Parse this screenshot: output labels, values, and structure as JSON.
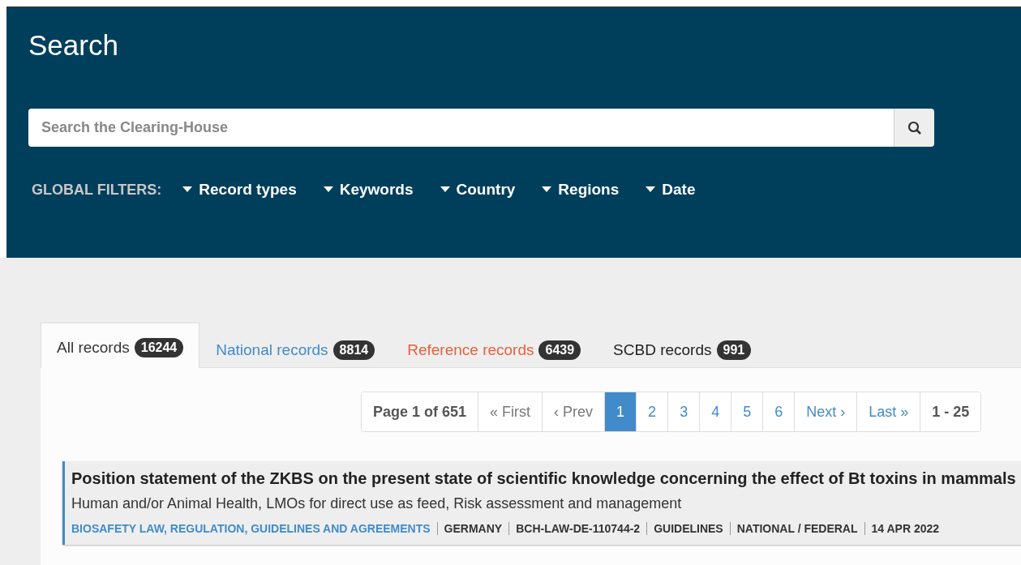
{
  "header": {
    "title": "Search",
    "search": {
      "placeholder": "Search the Clearing-House"
    },
    "filters_label": "GLOBAL FILTERS:",
    "filters": [
      "Record types",
      "Keywords",
      "Country",
      "Regions",
      "Date"
    ]
  },
  "tabs": [
    {
      "label": "All records",
      "count": "16244",
      "selected": true,
      "color": "#333333"
    },
    {
      "label": "National records",
      "count": "8814",
      "selected": false,
      "color": "#428bca"
    },
    {
      "label": "Reference records",
      "count": "6439",
      "selected": false,
      "color": "#e8603c"
    },
    {
      "label": "SCBD records",
      "count": "991",
      "selected": false,
      "color": "#222222"
    }
  ],
  "pager": [
    {
      "kind": "info",
      "label": "Page 1 of 651"
    },
    {
      "kind": "nav",
      "label": "« First",
      "disabled": true
    },
    {
      "kind": "nav",
      "label": "‹ Prev",
      "disabled": true
    },
    {
      "kind": "page",
      "label": "1",
      "selected": true
    },
    {
      "kind": "page",
      "label": "2",
      "selected": false
    },
    {
      "kind": "page",
      "label": "3",
      "selected": false
    },
    {
      "kind": "page",
      "label": "4",
      "selected": false
    },
    {
      "kind": "page",
      "label": "5",
      "selected": false
    },
    {
      "kind": "page",
      "label": "6",
      "selected": false
    },
    {
      "kind": "nav",
      "label": "Next ›",
      "disabled": false
    },
    {
      "kind": "nav",
      "label": "Last »",
      "disabled": false
    },
    {
      "kind": "info",
      "label": "1 - 25"
    }
  ],
  "results": [
    {
      "title": "Position statement of the ZKBS on the present state of scientific knowledge concerning the effect of Bt toxins in mammals",
      "subjects": "Human and/or Animal Health, LMOs for direct use as feed, Risk assessment and management",
      "meta": [
        {
          "kind": "link",
          "text": "BIOSAFETY LAW, REGULATION, GUIDELINES AND AGREEMENTS"
        },
        {
          "kind": "text",
          "text": "GERMANY"
        },
        {
          "kind": "text",
          "text": "BCH-LAW-DE-110744-2"
        },
        {
          "kind": "text",
          "text": "GUIDELINES"
        },
        {
          "kind": "text",
          "text": "NATIONAL / FEDERAL"
        },
        {
          "kind": "text",
          "text": "14 APR 2022"
        }
      ]
    }
  ]
}
